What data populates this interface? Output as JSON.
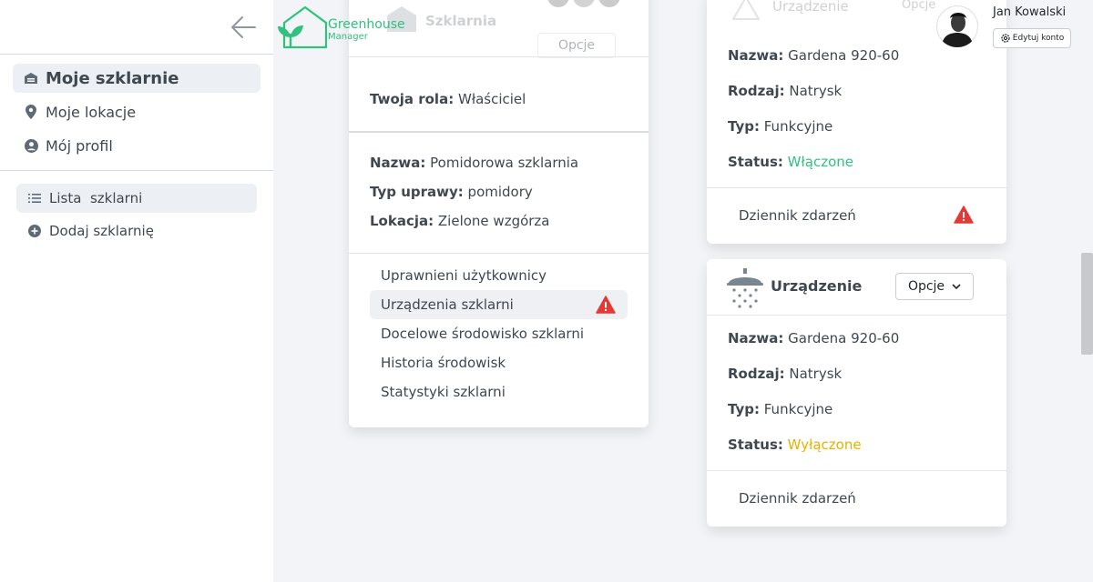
{
  "header": {
    "logo_title": "Greenhouse",
    "logo_subtitle": "Manager",
    "user_name": "Jan Kowalski",
    "edit_account": "Edytuj konto"
  },
  "sidebar": {
    "main_items": [
      {
        "label": "Moje szklarnie",
        "icon": "warehouse-icon",
        "active": true
      },
      {
        "label": "Moje lokacje",
        "icon": "map-pin-icon"
      },
      {
        "label": "Mój profil",
        "icon": "user-circle-icon"
      }
    ],
    "sub_items": [
      {
        "label": "Lista  szklarni",
        "icon": "list-icon",
        "active": true
      },
      {
        "label": "Dodaj szklarnię",
        "icon": "plus-circle-icon"
      }
    ]
  },
  "greenhouse_card": {
    "ghost_title": "Szklarnia",
    "ghost_options": "Opcje",
    "role_label": "Twoja rola:",
    "role_value": "Właściciel",
    "name_label": "Nazwa:",
    "name_value": "Pomidorowa szklarnia",
    "crop_label": "Typ uprawy:",
    "crop_value": "pomidory",
    "location_label": "Lokacja:",
    "location_value": "Zielone wzgórza",
    "menu": [
      {
        "label": "Uprawnieni użytkownicy"
      },
      {
        "label": "Urządzenia szklarni",
        "active": true,
        "warning": true
      },
      {
        "label": "Docelowe środowisko szklarni"
      },
      {
        "label": "Historia środowisk"
      },
      {
        "label": "Statystyki szklarni"
      }
    ]
  },
  "devices": [
    {
      "ghost_title": "Urządzenie",
      "ghost_options": "Opcje",
      "name_label": "Nazwa:",
      "name_value": "Gardena 920-60",
      "kind_label": "Rodzaj:",
      "kind_value": "Natrysk",
      "type_label": "Typ:",
      "type_value": "Funkcyjne",
      "status_label": "Status:",
      "status_value": "Włączone",
      "log_label": "Dziennik zdarzeń",
      "warning": true
    },
    {
      "title": "Urządzenie",
      "options": "Opcje",
      "name_label": "Nazwa:",
      "name_value": "Gardena 920-60",
      "kind_label": "Rodzaj:",
      "kind_value": "Natrysk",
      "type_label": "Typ:",
      "type_value": "Funkcyjne",
      "status_label": "Status:",
      "status_value": "Wyłączone",
      "log_label": "Dziennik zdarzeń"
    }
  ],
  "colors": {
    "brand_green": "#2ec27e",
    "status_on": "#2ec27e",
    "status_off": "#e8b100",
    "warning_red": "#e53935"
  }
}
